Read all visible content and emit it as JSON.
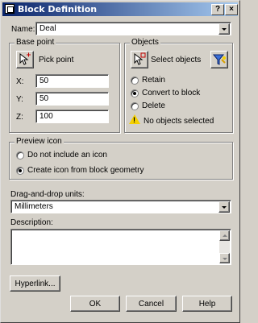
{
  "window": {
    "title": "Block Definition",
    "help_glyph": "?",
    "close_glyph": "×"
  },
  "name": {
    "label": "Name:",
    "value": "Deal"
  },
  "base_point": {
    "title": "Base point",
    "pick_label": "Pick point",
    "x_label": "X:",
    "x_value": "50",
    "y_label": "Y:",
    "y_value": "50",
    "z_label": "Z:",
    "z_value": "100"
  },
  "objects": {
    "title": "Objects",
    "select_label": "Select objects",
    "options": [
      "Retain",
      "Convert to block",
      "Delete"
    ],
    "selected": "Convert to block",
    "status": "No objects selected"
  },
  "preview": {
    "title": "Preview icon",
    "options": [
      "Do not include an icon",
      "Create icon from block geometry"
    ],
    "selected": "Create icon from block geometry"
  },
  "units": {
    "label": "Drag-and-drop units:",
    "value": "Millimeters"
  },
  "description": {
    "label": "Description:",
    "value": ""
  },
  "buttons": {
    "hyperlink": "Hyperlink...",
    "ok": "OK",
    "cancel": "Cancel",
    "help": "Help"
  }
}
